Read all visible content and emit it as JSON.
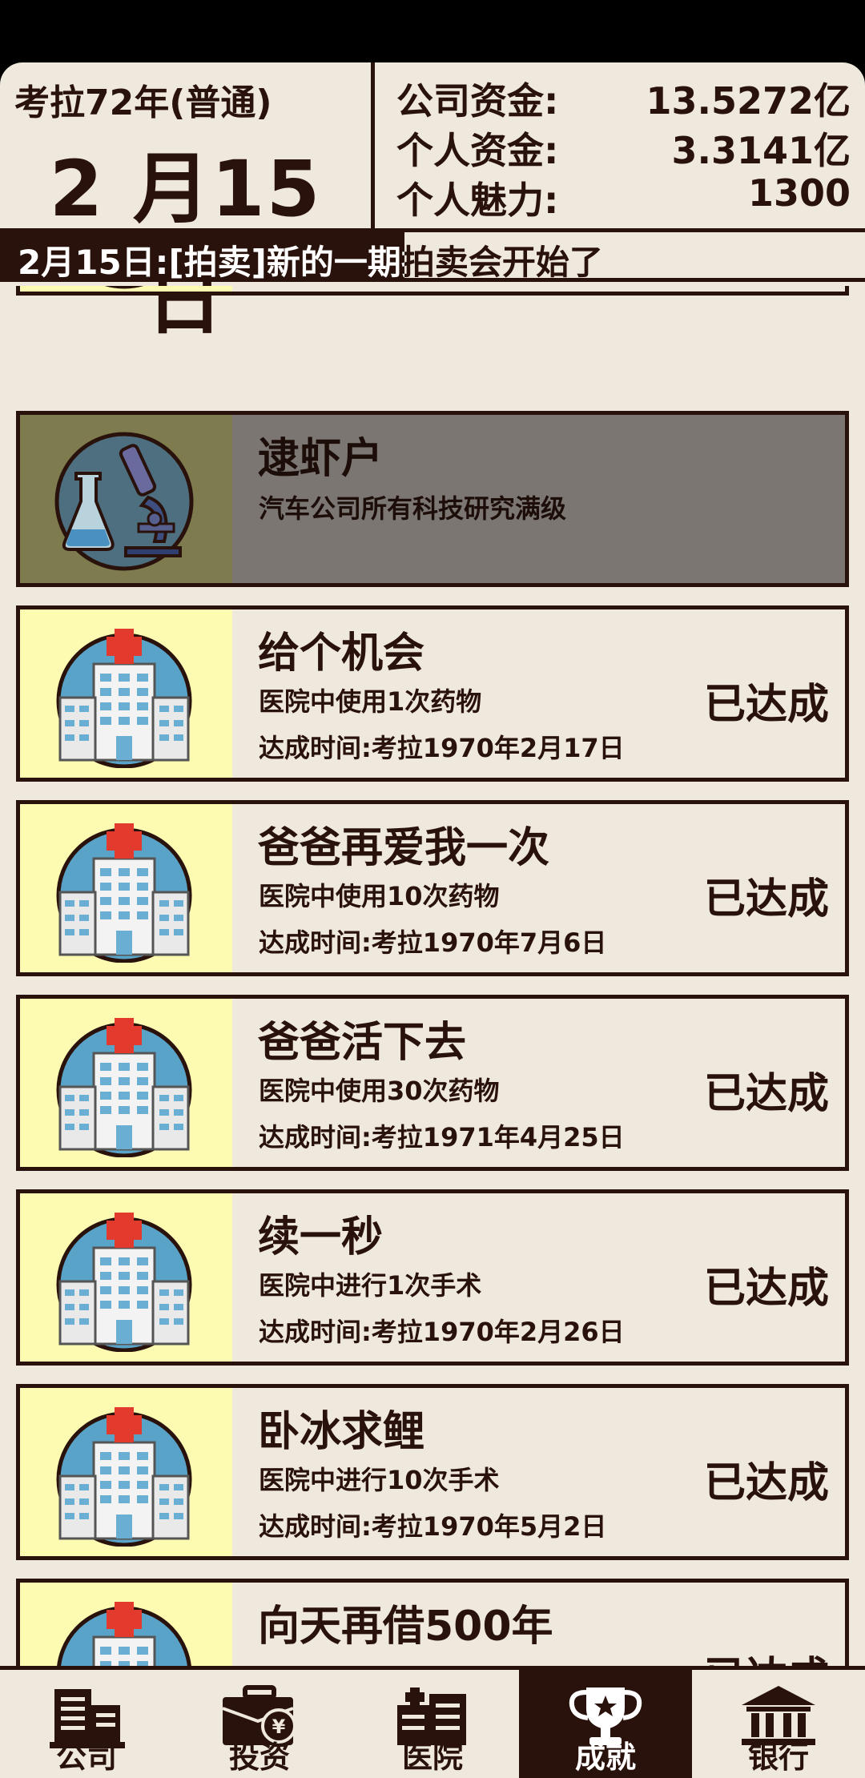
{
  "header": {
    "year_label": "考拉72年(普通)",
    "day_label": "2 月15 日",
    "company_funds_label": "公司资金:",
    "company_funds_value": "13.5272亿",
    "personal_funds_label": "个人资金:",
    "personal_funds_value": "3.3141亿",
    "charm_label": "个人魅力:",
    "charm_value": "1300"
  },
  "news": {
    "text": "2月15日:[拍卖]新的一期拍卖会开始了"
  },
  "achievements": [
    {
      "title": "逮虾户",
      "desc": "汽车公司所有科技研究满级",
      "time": "",
      "status": "",
      "icon": "lab-icon",
      "achieved": false
    },
    {
      "title": "给个机会",
      "desc": "医院中使用1次药物",
      "time": "达成时间:考拉1970年2月17日",
      "status": "已达成",
      "icon": "hospital-icon",
      "achieved": true
    },
    {
      "title": "爸爸再爱我一次",
      "desc": "医院中使用10次药物",
      "time": "达成时间:考拉1970年7月6日",
      "status": "已达成",
      "icon": "hospital-icon",
      "achieved": true
    },
    {
      "title": "爸爸活下去",
      "desc": "医院中使用30次药物",
      "time": "达成时间:考拉1971年4月25日",
      "status": "已达成",
      "icon": "hospital-icon",
      "achieved": true
    },
    {
      "title": "续一秒",
      "desc": "医院中进行1次手术",
      "time": "达成时间:考拉1970年2月26日",
      "status": "已达成",
      "icon": "hospital-icon",
      "achieved": true
    },
    {
      "title": "卧冰求鲤",
      "desc": "医院中进行10次手术",
      "time": "达成时间:考拉1970年5月2日",
      "status": "已达成",
      "icon": "hospital-icon",
      "achieved": true
    },
    {
      "title": "向天再借500年",
      "desc": "",
      "time": "",
      "status": "已达成",
      "icon": "hospital-icon",
      "achieved": true
    }
  ],
  "nav": [
    {
      "label": "公司",
      "icon": "company-icon",
      "active": false
    },
    {
      "label": "投资",
      "icon": "investment-icon",
      "active": false
    },
    {
      "label": "医院",
      "icon": "hospital-building-icon",
      "active": false
    },
    {
      "label": "成就",
      "icon": "trophy-icon",
      "active": true
    },
    {
      "label": "银行",
      "icon": "bank-icon",
      "active": false
    }
  ],
  "colors": {
    "dark": "#2a120c",
    "background": "#efe8dc",
    "thumb": "#fdfab2",
    "locked": "#7b7672"
  }
}
